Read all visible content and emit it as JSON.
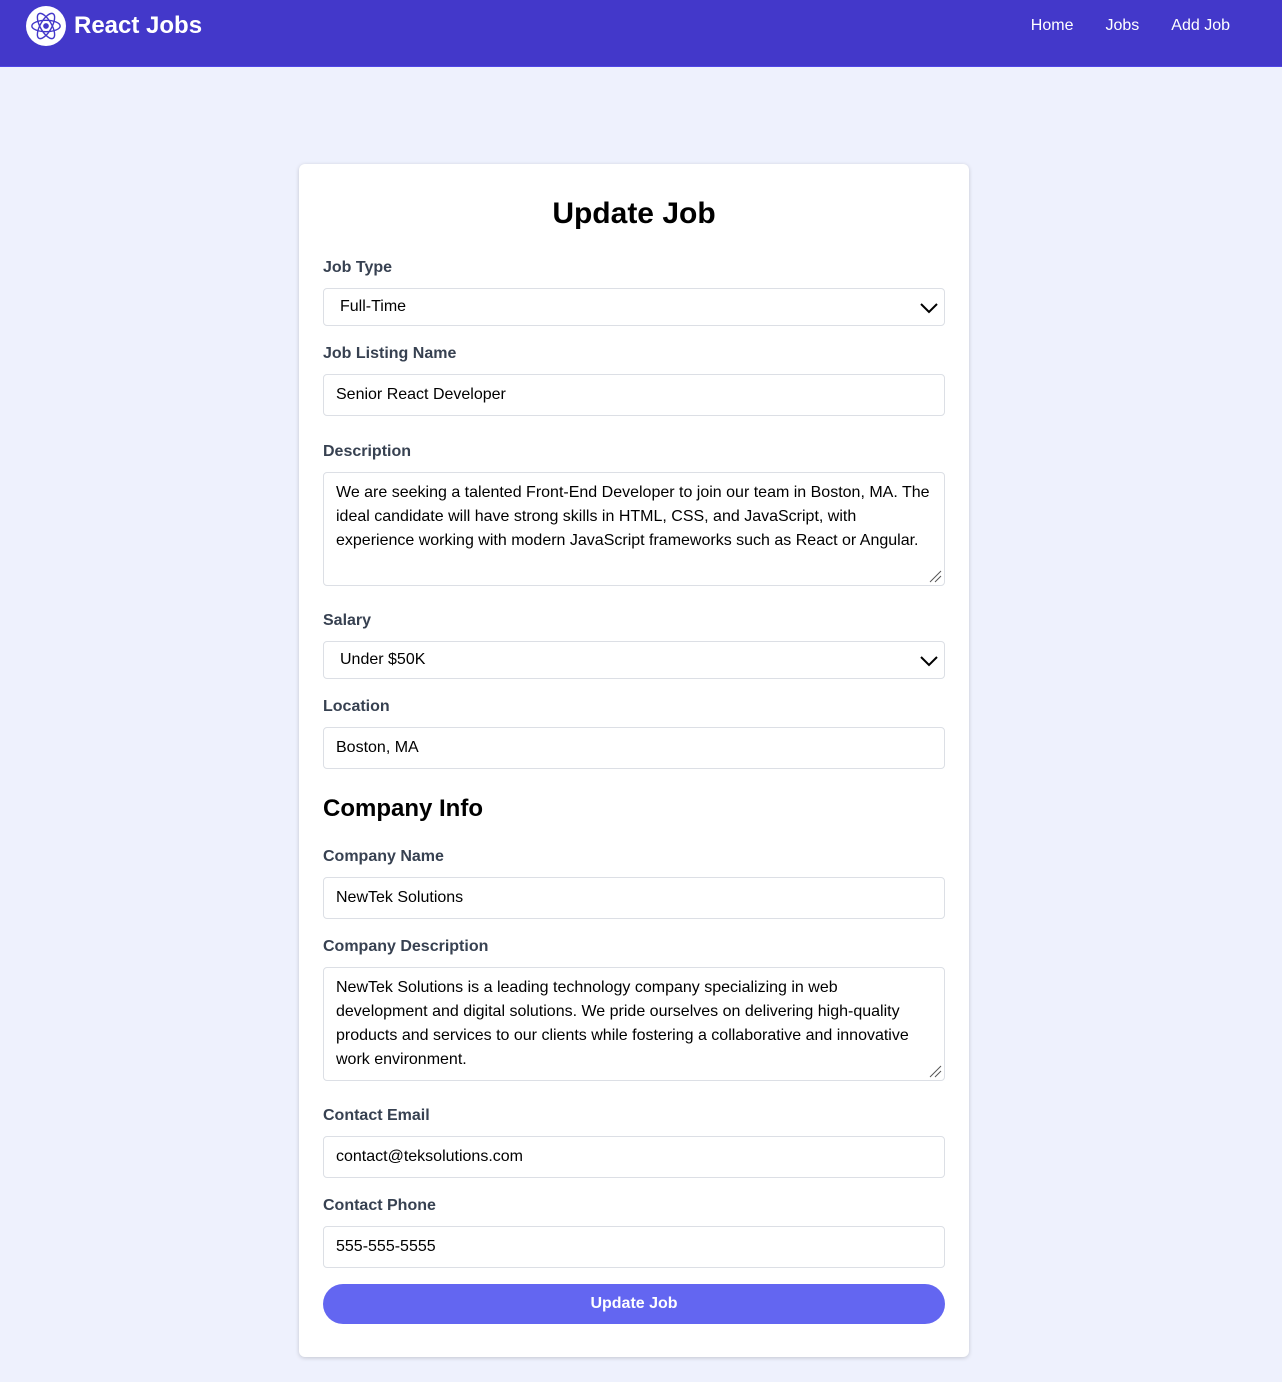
{
  "navbar": {
    "brand": "React Jobs",
    "links": [
      {
        "label": "Home"
      },
      {
        "label": "Jobs"
      },
      {
        "label": "Add Job"
      }
    ]
  },
  "form": {
    "title": "Update Job",
    "job_type": {
      "label": "Job Type",
      "value": "Full-Time"
    },
    "listing_name": {
      "label": "Job Listing Name",
      "value": "Senior React Developer"
    },
    "description": {
      "label": "Description",
      "value": "We are seeking a talented Front-End Developer to join our team in Boston, MA. The ideal candidate will have strong skills in HTML, CSS, and JavaScript, with experience working with modern JavaScript frameworks such as React or Angular."
    },
    "salary": {
      "label": "Salary",
      "value": "Under $50K"
    },
    "location": {
      "label": "Location",
      "value": "Boston, MA"
    },
    "company_section_title": "Company Info",
    "company_name": {
      "label": "Company Name",
      "value": "NewTek Solutions"
    },
    "company_description": {
      "label": "Company Description",
      "value": "NewTek Solutions is a leading technology company specializing in web development and digital solutions. We pride ourselves on delivering high-quality products and services to our clients while fostering a collaborative and innovative work environment."
    },
    "contact_email": {
      "label": "Contact Email",
      "value": "contact@teksolutions.com"
    },
    "contact_phone": {
      "label": "Contact Phone",
      "value": "555-555-5555"
    },
    "submit_label": "Update Job"
  },
  "colors": {
    "navbar": "#4338ca",
    "page_background": "#eef1fd",
    "button": "#6366f1",
    "label_text": "#374151"
  }
}
